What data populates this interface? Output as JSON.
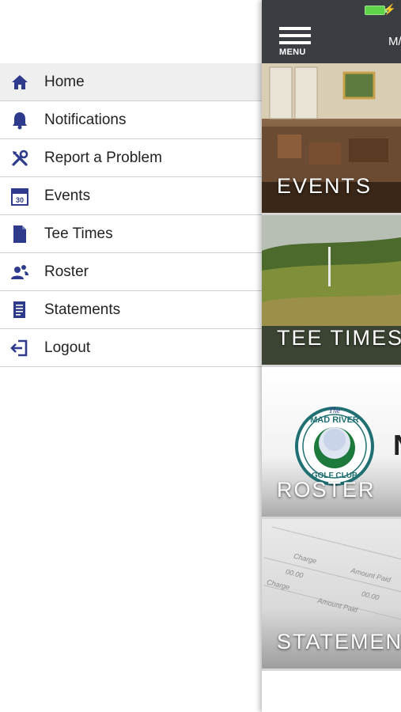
{
  "drawer": {
    "items": [
      {
        "label": "Home",
        "icon": "home-icon",
        "active": true
      },
      {
        "label": "Notifications",
        "icon": "bell-icon"
      },
      {
        "label": "Report a Problem",
        "icon": "tools-icon"
      },
      {
        "label": "Events",
        "icon": "calendar-icon",
        "calendar_day": "30"
      },
      {
        "label": "Tee Times",
        "icon": "document-icon"
      },
      {
        "label": "Roster",
        "icon": "people-icon"
      },
      {
        "label": "Statements",
        "icon": "statement-icon"
      },
      {
        "label": "Logout",
        "icon": "logout-icon"
      }
    ],
    "accent_color": "#2e3a8c"
  },
  "main": {
    "menu_label": "MENU",
    "title_partial": "M/",
    "tiles": [
      {
        "caption": "EVENTS"
      },
      {
        "caption": "TEE TIMES"
      },
      {
        "caption": "ROSTER",
        "logo_text": [
          "The",
          "MAD RIVER",
          "GOLF CLUB"
        ],
        "side_letter": "N"
      },
      {
        "caption": "STATEMENTS",
        "doc_words": [
          "Charge",
          "Amount Paid",
          "Charge",
          "Amount Paid",
          "00.00",
          "00.00"
        ]
      }
    ]
  },
  "status_bar": {
    "battery_color": "#5fd34a"
  }
}
